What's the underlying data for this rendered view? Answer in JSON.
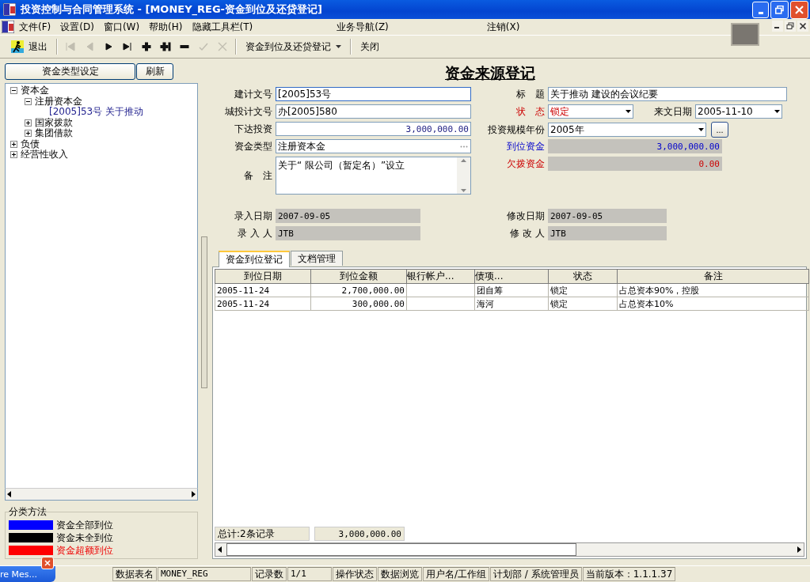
{
  "window": {
    "title": "投资控制与合同管理系统 - [MONEY_REG-资金到位及还贷登记]"
  },
  "menu": [
    "文件(F)",
    "设置(D)",
    "窗口(W)",
    "帮助(H)",
    "隐藏工具栏(T)",
    "业务导航(Z)",
    "注销(X)"
  ],
  "toolbar": [
    {
      "kind": "exit",
      "label": "退出",
      "disabled": false
    },
    {
      "kind": "first",
      "disabled": true
    },
    {
      "kind": "prev",
      "disabled": true
    },
    {
      "kind": "next",
      "disabled": false
    },
    {
      "kind": "last",
      "disabled": false
    },
    {
      "kind": "add",
      "disabled": false
    },
    {
      "kind": "insert",
      "disabled": false
    },
    {
      "kind": "remove",
      "disabled": false
    },
    {
      "kind": "confirm",
      "disabled": true
    },
    {
      "kind": "cancel",
      "disabled": true
    },
    {
      "kind": "dropdown",
      "label": "资金到位及还贷登记",
      "disabled": false
    },
    {
      "kind": "text",
      "label": "关闭",
      "disabled": false
    }
  ],
  "sidebar": {
    "buttons": [
      "资金类型设定",
      "刷新"
    ],
    "tree": [
      {
        "label": "资本金",
        "expanded": true,
        "children": [
          {
            "label": "注册资本金",
            "expanded": true,
            "children": [
              {
                "label": "[2005]53号 关于推动"
              }
            ]
          },
          {
            "label": "国家拨款",
            "expanded": false
          },
          {
            "label": "集团借款",
            "expanded": false
          }
        ]
      },
      {
        "label": "负债",
        "expanded": false
      },
      {
        "label": "经营性收入",
        "expanded": false
      }
    ],
    "legend": {
      "title": "分类方法",
      "items": [
        {
          "label": "资金全部到位",
          "color": "#0000ff",
          "alert": false
        },
        {
          "label": "资金未全到位",
          "color": "#000000",
          "alert": false
        },
        {
          "label": "资金超额到位",
          "color": "#ff0000",
          "alert": true
        }
      ]
    }
  },
  "form": {
    "title": "资金来源登记",
    "rows": [
      {
        "left": [
          {
            "label": "建计文号",
            "kind": "text",
            "value": "[2005]53号",
            "focused": true
          }
        ],
        "right": [
          {
            "label": "标　题",
            "kind": "text",
            "value": "关于推动 建设的会议纪要",
            "alert": false,
            "info": false
          }
        ]
      },
      {
        "left": [
          {
            "label": "城投计文号",
            "kind": "text",
            "value": "办[2005]580"
          }
        ],
        "right": [
          {
            "label": "状　态",
            "kind": "select",
            "value": "锁定",
            "alert": true,
            "info": false
          },
          {
            "label": "来文日期",
            "kind": "date",
            "value": "2005-11-10",
            "alert": false,
            "info": false
          }
        ]
      },
      {
        "left": [
          {
            "label": "下达投资",
            "kind": "amount",
            "value": "3,000,000.00"
          }
        ],
        "right": [
          {
            "label": "投资规模年份",
            "kind": "year",
            "value": "2005年",
            "button": "...",
            "alert": false,
            "info": false
          }
        ]
      },
      {
        "left": [
          {
            "label": "资金类型",
            "kind": "picker",
            "value": "注册资本金"
          }
        ],
        "right": [
          {
            "label": "到位资金",
            "kind": "total",
            "value": "3,000,000.00",
            "alert": false,
            "info": true
          }
        ]
      },
      {
        "left": [
          {
            "label": "备　注",
            "kind": "memo",
            "value": "关于“ 限公司（暂定名）”设立"
          }
        ],
        "right": [
          {
            "label": "欠拨资金",
            "kind": "total",
            "value": "0.00",
            "alert": true,
            "info": false
          }
        ]
      },
      {
        "left": [
          {
            "label": "录入日期",
            "kind": "readonly",
            "value": "2007-09-05"
          }
        ],
        "right": [
          {
            "label": "修改日期",
            "kind": "readonly",
            "value": "2007-09-05",
            "alert": false,
            "info": false
          }
        ]
      },
      {
        "left": [
          {
            "label": "录 入 人",
            "kind": "readonly",
            "value": "JTB"
          }
        ],
        "right": [
          {
            "label": "修 改 人",
            "kind": "readonly",
            "value": "JTB",
            "alert": false,
            "info": false
          }
        ]
      }
    ]
  },
  "tabs": [
    {
      "label": "资金到位登记",
      "selected": true
    },
    {
      "label": "文档管理",
      "selected": false
    }
  ],
  "table": {
    "columns": [
      "到位日期",
      "到位金额",
      "银行帐户...",
      "债项...",
      "状态",
      "备注"
    ],
    "rows": [
      {
        "cells": [
          "2005-11-24",
          "2,700,000.00",
          "",
          "团自筹",
          "锁定",
          "占总资本90%，控股"
        ]
      },
      {
        "cells": [
          "2005-11-24",
          "300,000.00",
          "",
          "海河",
          "锁定",
          "占总资本10%"
        ]
      }
    ],
    "footer": {
      "count": "总计:2条记录",
      "sum": "3,000,000.00"
    }
  },
  "status_bar": {
    "notice": "re Mes...",
    "fields": [
      {
        "label": "数据表名",
        "value": "MONEY_REG"
      },
      {
        "label": "记录数",
        "value": "1/1"
      },
      {
        "label": "操作状态",
        "value": "数据浏览"
      },
      {
        "label": "用户名/工作组",
        "value": "计划部 / 系统管理员"
      }
    ],
    "version": "当前版本：1.1.1.37"
  }
}
